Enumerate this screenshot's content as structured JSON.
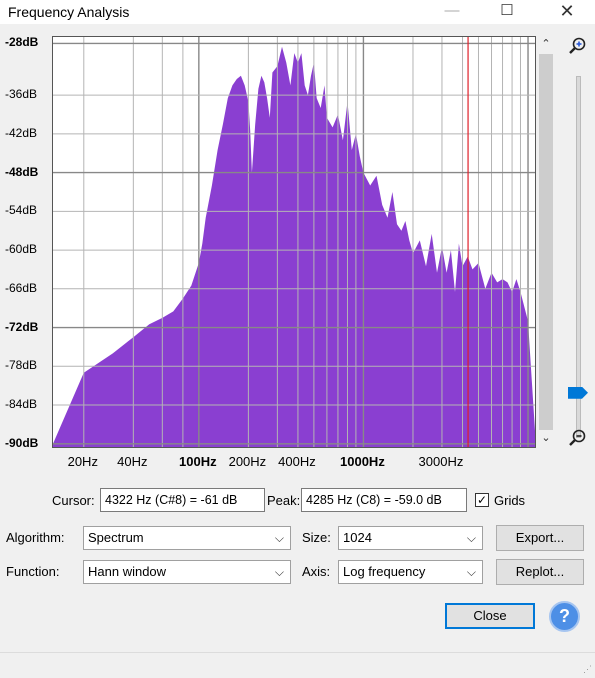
{
  "window": {
    "title": "Frequency Analysis",
    "min_glyph": "—",
    "max_glyph": "☐",
    "close_glyph": "✕"
  },
  "plot": {
    "y_labels": [
      {
        "text": "-28dB",
        "db": -28,
        "bold": true
      },
      {
        "text": "-36dB",
        "db": -36,
        "bold": false
      },
      {
        "text": "-42dB",
        "db": -42,
        "bold": false
      },
      {
        "text": "-48dB",
        "db": -48,
        "bold": true
      },
      {
        "text": "-54dB",
        "db": -54,
        "bold": false
      },
      {
        "text": "-60dB",
        "db": -60,
        "bold": false
      },
      {
        "text": "-66dB",
        "db": -66,
        "bold": false
      },
      {
        "text": "-72dB",
        "db": -72,
        "bold": true
      },
      {
        "text": "-78dB",
        "db": -78,
        "bold": false
      },
      {
        "text": "-84dB",
        "db": -84,
        "bold": false
      },
      {
        "text": "-90dB",
        "db": -90,
        "bold": true
      }
    ],
    "x_labels": [
      {
        "text": "20Hz",
        "hz": 20,
        "bold": false
      },
      {
        "text": "40Hz",
        "hz": 40,
        "bold": false
      },
      {
        "text": "100Hz",
        "hz": 100,
        "bold": true
      },
      {
        "text": "200Hz",
        "hz": 200,
        "bold": false
      },
      {
        "text": "400Hz",
        "hz": 400,
        "bold": false
      },
      {
        "text": "1000Hz",
        "hz": 1000,
        "bold": true
      },
      {
        "text": "3000Hz",
        "hz": 3000,
        "bold": false
      }
    ],
    "fill_color": "#8a3fd1",
    "cursor_color": "#e0202a",
    "grid_color": "#b4b4b4",
    "cursor_hz": 4322
  },
  "chart_data": {
    "type": "area",
    "x_scale": "log",
    "xlim": [
      13,
      11025
    ],
    "ylim": [
      -90.5,
      -27
    ],
    "xlabel": "",
    "ylabel": "",
    "grid": true,
    "x": [
      13,
      20,
      30,
      40,
      50,
      60,
      70,
      80,
      90,
      100,
      105,
      110,
      120,
      130,
      140,
      150,
      160,
      170,
      180,
      190,
      200,
      205,
      210,
      220,
      230,
      240,
      250,
      260,
      270,
      280,
      300,
      320,
      340,
      360,
      380,
      400,
      420,
      440,
      460,
      480,
      500,
      520,
      550,
      580,
      600,
      650,
      700,
      750,
      800,
      850,
      900,
      950,
      1000,
      1100,
      1200,
      1300,
      1400,
      1500,
      1600,
      1700,
      1800,
      1900,
      2000,
      2200,
      2400,
      2600,
      2800,
      3000,
      3200,
      3400,
      3600,
      3800,
      4000,
      4300,
      4600,
      5000,
      5500,
      6000,
      6500,
      7000,
      7500,
      8000,
      8500,
      9000,
      10000,
      11025
    ],
    "values": [
      -90,
      -79,
      -76,
      -73.5,
      -71.5,
      -70.5,
      -69.5,
      -67.5,
      -65.5,
      -62,
      -59,
      -55,
      -50,
      -44.5,
      -40.5,
      -36.5,
      -34.5,
      -33.5,
      -33,
      -34.5,
      -37,
      -41.5,
      -48,
      -40.5,
      -35,
      -33,
      -34,
      -36.5,
      -39.5,
      -32.5,
      -31.5,
      -28.5,
      -31,
      -34.5,
      -29.5,
      -31,
      -29.5,
      -34.5,
      -36,
      -33,
      -31,
      -36.5,
      -38,
      -34.5,
      -39.5,
      -41,
      -39,
      -43,
      -37,
      -44.5,
      -42,
      -45.5,
      -48,
      -50,
      -48.5,
      -53,
      -55,
      -51,
      -56,
      -57,
      -55.5,
      -58.5,
      -60.5,
      -58.5,
      -62.5,
      -57.5,
      -63.5,
      -59.5,
      -63.5,
      -60,
      -66.5,
      -59,
      -62.5,
      -61,
      -63,
      -62,
      -66,
      -63.5,
      -65,
      -64.5,
      -65,
      -66.5,
      -64.5,
      -66.5,
      -71,
      -88
    ]
  },
  "cursor": {
    "label": "Cursor:",
    "value": "4322 Hz (C#8) = -61 dB"
  },
  "peak": {
    "label": "Peak:",
    "value": "4285 Hz (C8) = -59.0 dB"
  },
  "grids": {
    "label": "Grids",
    "checked_glyph": "✓"
  },
  "algorithm": {
    "label": "Algorithm:",
    "value": "Spectrum"
  },
  "size": {
    "label": "Size:",
    "value": "1024"
  },
  "function": {
    "label": "Function:",
    "value": "Hann window"
  },
  "axis": {
    "label": "Axis:",
    "value": "Log frequency"
  },
  "buttons": {
    "export": "Export...",
    "replot": "Replot...",
    "close": "Close",
    "help": "?"
  },
  "scroll": {
    "up": "⌃",
    "down": "⌄"
  },
  "zoom": {
    "in_icon": "zoom-in-icon",
    "out_icon": "zoom-out-icon",
    "level": 0.12
  }
}
